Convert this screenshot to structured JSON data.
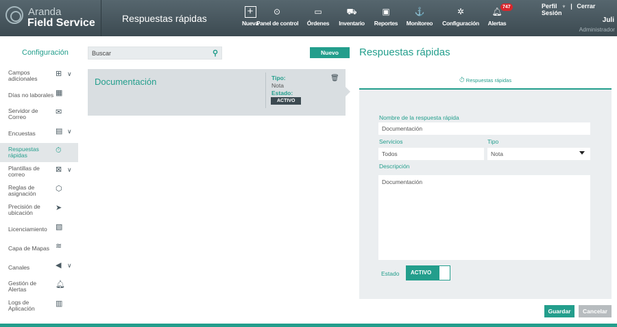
{
  "header": {
    "brand_top": "Aranda",
    "brand_bottom": "Field Service",
    "page_title": "Respuestas rápidas",
    "nav": [
      {
        "label": "Nueva",
        "icon": "plus-icon"
      },
      {
        "label": "Panel de control",
        "icon": "dashboard-icon"
      },
      {
        "label": "Órdenes",
        "icon": "orders-icon"
      },
      {
        "label": "Inventario",
        "icon": "inventory-icon"
      },
      {
        "label": "Reportes",
        "icon": "reports-icon"
      },
      {
        "label": "Monitoreo",
        "icon": "monitoring-icon"
      },
      {
        "label": "Configuración",
        "icon": "gear-icon"
      },
      {
        "label": "Alertas",
        "icon": "bell-icon",
        "badge": "747"
      }
    ],
    "perfil": "Perfil",
    "cerrar": "Cerrar Sesión",
    "user": "Juli",
    "role": "Administrador"
  },
  "sidebar": {
    "title": "Configuración",
    "items": [
      {
        "label": "Campos adicionales",
        "icon": "add-box-icon",
        "chevron": true
      },
      {
        "label": "Días no laborales",
        "icon": "calendar-icon"
      },
      {
        "label": "Servidor de Correo",
        "icon": "envelope-icon"
      },
      {
        "label": "Encuestas",
        "icon": "survey-icon",
        "chevron": true
      },
      {
        "label": "Respuestas rápidas",
        "icon": "stopwatch-icon",
        "active": true
      },
      {
        "label": "Plantillas de correo",
        "icon": "mail-template-icon",
        "chevron": true
      },
      {
        "label": "Reglas de asignación",
        "icon": "cube-icon"
      },
      {
        "label": "Precisión de ubicación",
        "icon": "location-arrow-icon"
      },
      {
        "label": "Licenciamiento",
        "icon": "license-icon"
      },
      {
        "label": "Capa de Mapas",
        "icon": "map-layers-icon"
      },
      {
        "label": "Canales",
        "icon": "megaphone-icon",
        "chevron": true
      },
      {
        "label": "Gestión de Alertas",
        "icon": "bell-icon"
      },
      {
        "label": "Logs de Aplicación",
        "icon": "log-icon"
      }
    ]
  },
  "list": {
    "search_placeholder": "Buscar",
    "new_button": "Nuevo",
    "card": {
      "title": "Documentación",
      "tipo_label": "Tipo:",
      "tipo_value": "Nota",
      "estado_label": "Estado:",
      "estado_value": "ACTIVO"
    }
  },
  "detail": {
    "title": "Respuestas rápidas",
    "panel_tab": "Respuestas rápidas",
    "name_label": "Nombre de la respuesta rápida",
    "name_value": "Documentación",
    "servicios_label": "Servicios",
    "servicios_value": "Todos",
    "tipo_label": "Tipo",
    "tipo_value": "Nota",
    "descripcion_label": "Descripción",
    "descripcion_value": "Documentación",
    "estado_label": "Estado",
    "estado_value": "ACTIVO",
    "save": "Guardar",
    "cancel": "Cancelar"
  },
  "colors": {
    "accent": "#239e8c",
    "header": "#3c4a51",
    "badge": "#d9262c"
  }
}
